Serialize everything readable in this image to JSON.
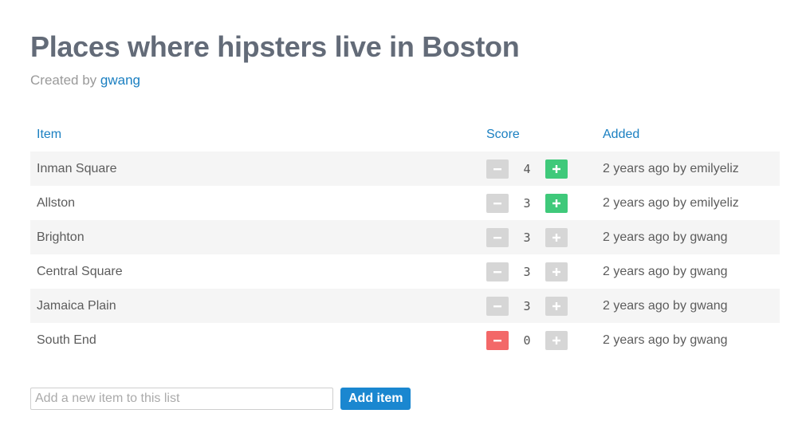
{
  "page": {
    "title": "Places where hipsters live in Boston",
    "created_by_prefix": "Created by",
    "created_by_user": "gwang"
  },
  "table": {
    "headers": {
      "item": "Item",
      "score": "Score",
      "added": "Added"
    },
    "rows": [
      {
        "item": "Inman Square",
        "score": "4",
        "added": "2 years ago by emilyeliz",
        "vote": "up"
      },
      {
        "item": "Allston",
        "score": "3",
        "added": "2 years ago by emilyeliz",
        "vote": "up"
      },
      {
        "item": "Brighton",
        "score": "3",
        "added": "2 years ago by gwang",
        "vote": "none"
      },
      {
        "item": "Central Square",
        "score": "3",
        "added": "2 years ago by gwang",
        "vote": "none"
      },
      {
        "item": "Jamaica Plain",
        "score": "3",
        "added": "2 years ago by gwang",
        "vote": "none"
      },
      {
        "item": "South End",
        "score": "0",
        "added": "2 years ago by gwang",
        "vote": "down"
      }
    ]
  },
  "add_form": {
    "placeholder": "Add a new item to this list",
    "value": "",
    "button_label": "Add item"
  },
  "icons": {
    "downvote": "minus-icon",
    "upvote": "plus-icon"
  },
  "colors": {
    "title": "#636b78",
    "link": "#1a7fc1",
    "upvote_active": "#3fc97a",
    "downvote_active": "#f36868",
    "vote_inactive": "#d6d6d6",
    "add_button": "#1a87d0"
  }
}
